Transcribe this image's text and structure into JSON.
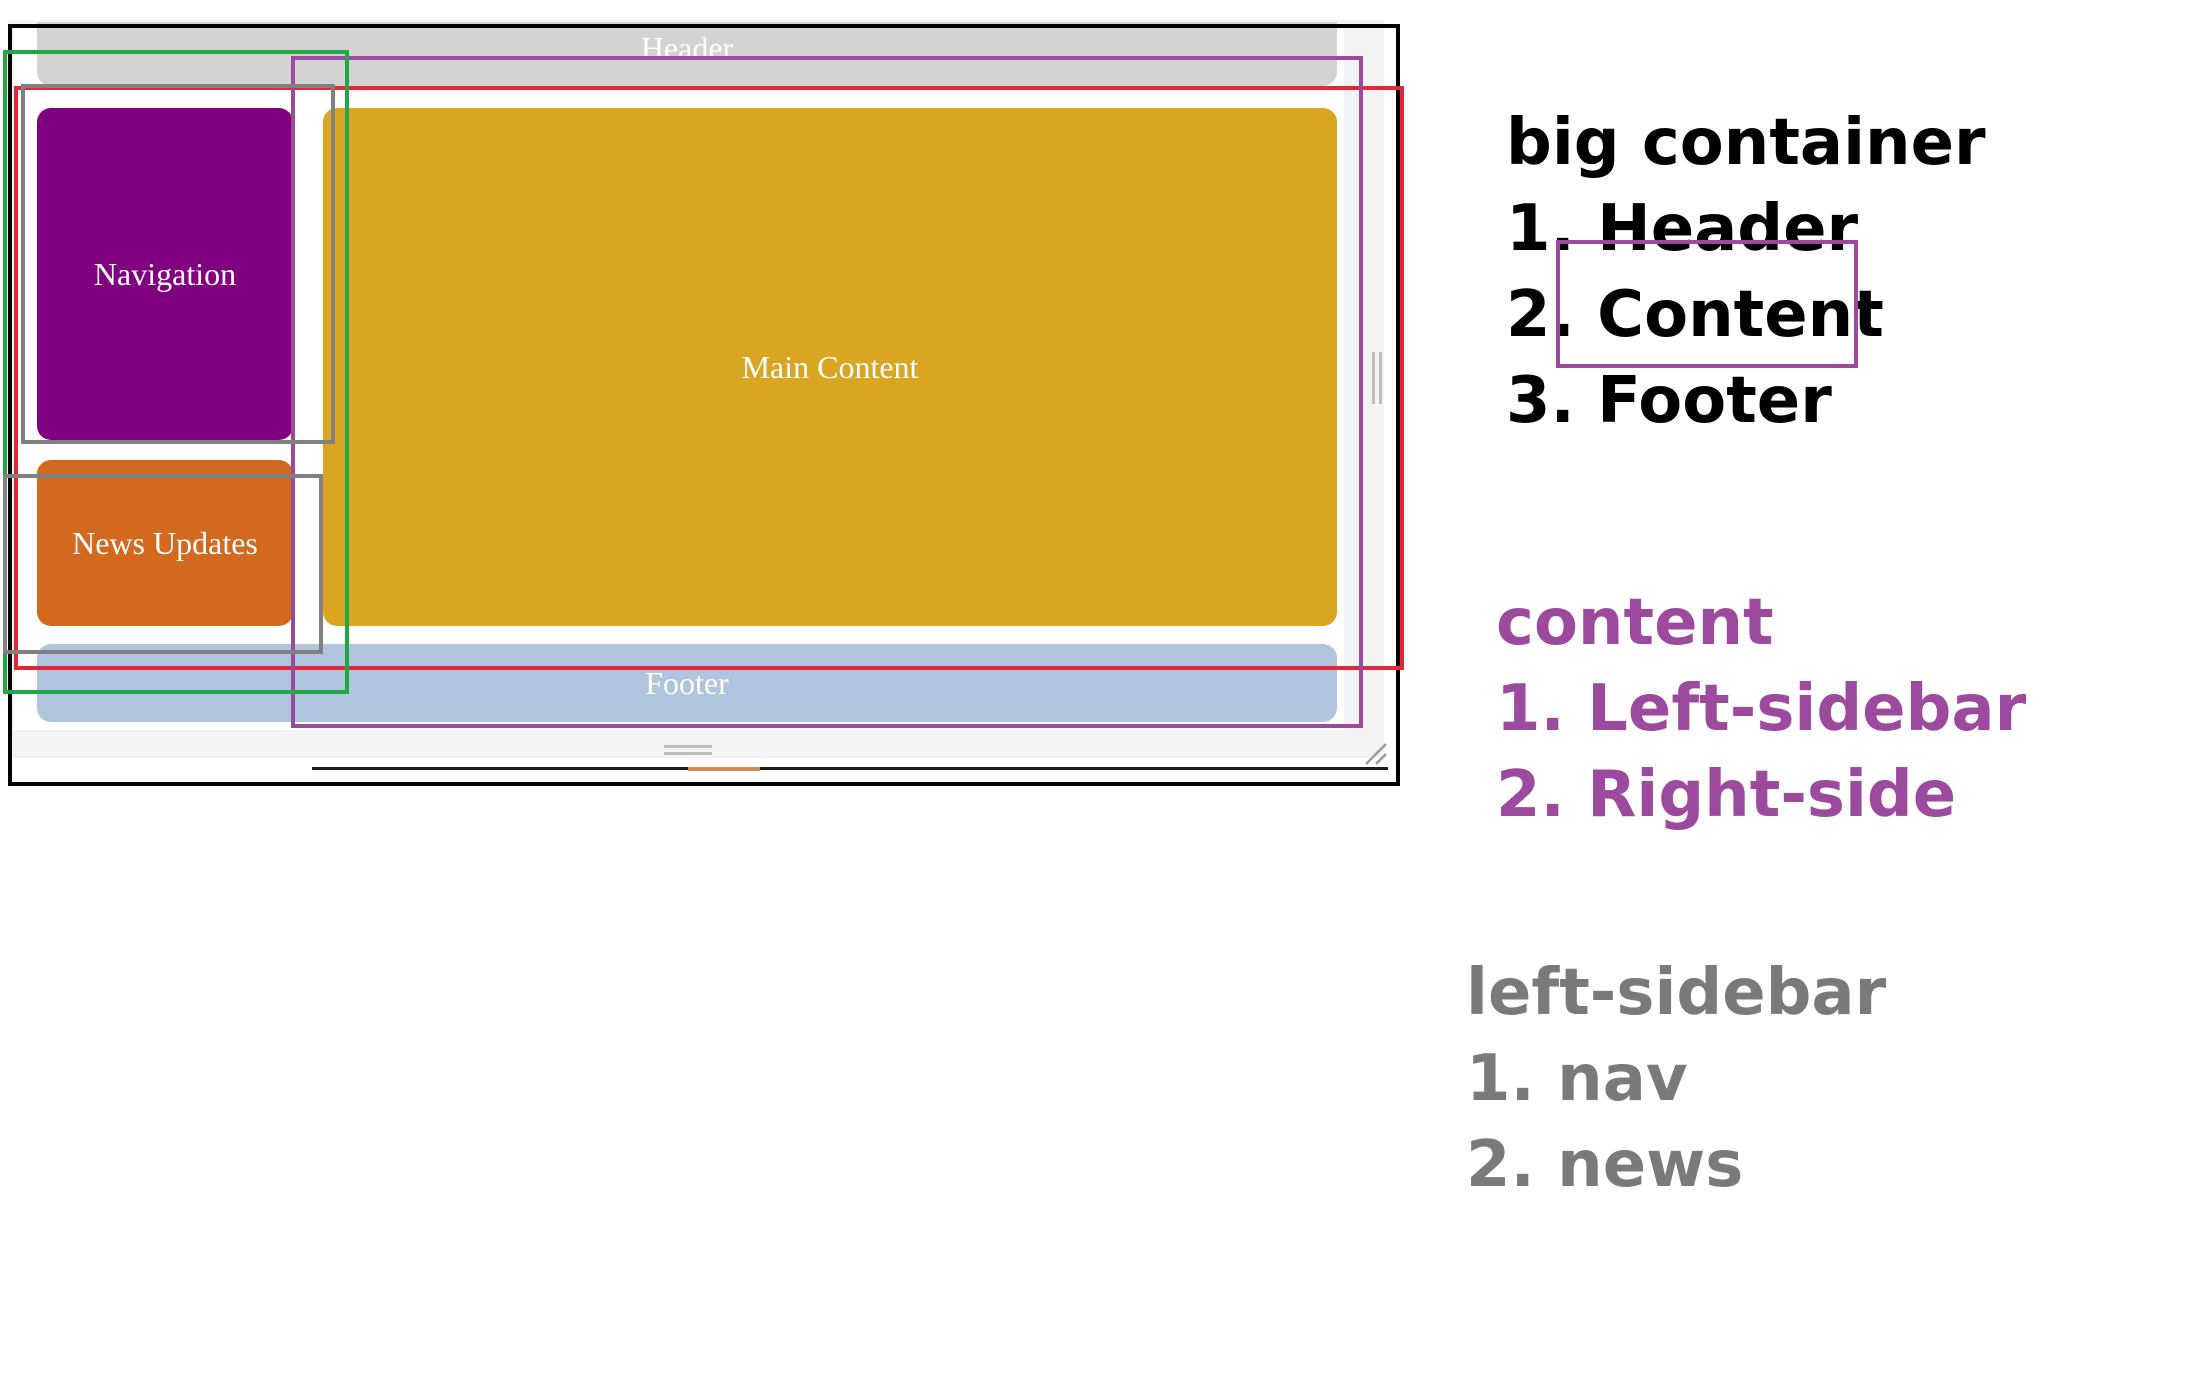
{
  "diagram": {
    "blocks": {
      "header": "Header",
      "navigation": "Navigation",
      "main_content": "Main Content",
      "news_updates": "News Updates",
      "footer": "Footer"
    },
    "block_colors": {
      "header": "#d3d3d3",
      "navigation": "#800080",
      "main_content": "#daa520",
      "news_updates": "#d2691e",
      "footer": "#b0c4de"
    },
    "annotation_colors": {
      "big_container": "#000000",
      "content": "#9c4a9e",
      "left_sidebar_group": "#22a646",
      "inner_region": "#e0283c",
      "left_sidebar_items": "#808080"
    }
  },
  "legend": {
    "big_container": {
      "title": "big container",
      "items": [
        "1. Header",
        "2. Content",
        "3. Footer"
      ]
    },
    "content": {
      "title": "content",
      "items": [
        "1. Left-sidebar",
        "2. Right-side"
      ]
    },
    "left_sidebar": {
      "title": "left-sidebar",
      "items": [
        "1. nav",
        "2. news"
      ]
    }
  }
}
